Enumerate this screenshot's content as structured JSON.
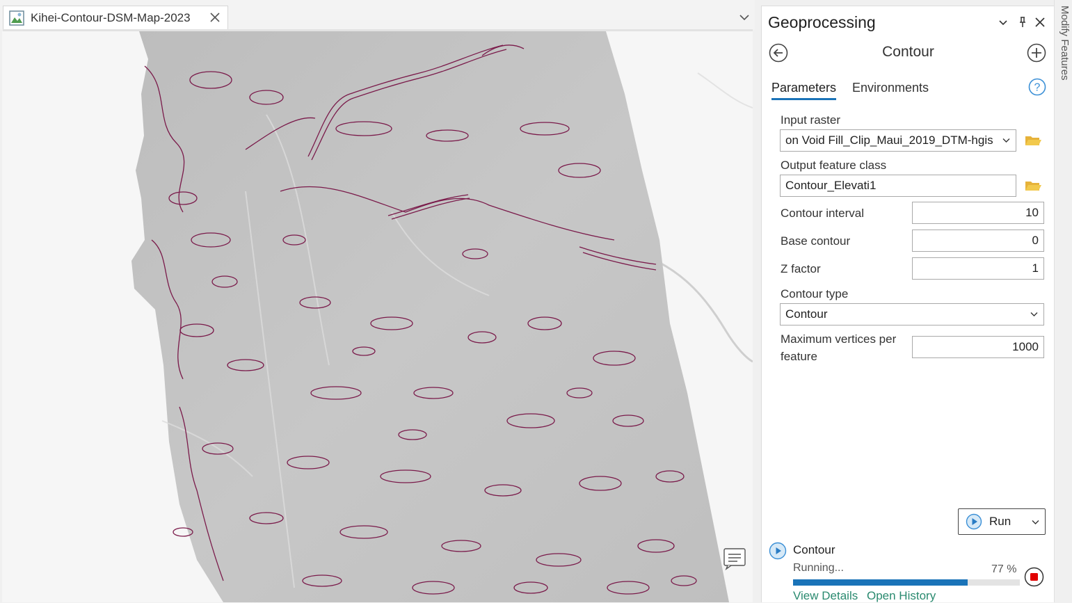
{
  "map_view": {
    "tab_title": "Kihei-Contour-DSM-Map-2023",
    "map_icon": "map-icon",
    "contour_color": "#7a1a4a"
  },
  "geoprocessing": {
    "pane_title": "Geoprocessing",
    "tool_name": "Contour",
    "tabs": {
      "parameters": "Parameters",
      "environments": "Environments"
    },
    "parameters": {
      "input_raster": {
        "label": "Input raster",
        "value": "on Void Fill_Clip_Maui_2019_DTM-hgis"
      },
      "output_feature_class": {
        "label": "Output feature class",
        "value": "Contour_Elevati1"
      },
      "contour_interval": {
        "label": "Contour interval",
        "value": "10"
      },
      "base_contour": {
        "label": "Base contour",
        "value": "0"
      },
      "z_factor": {
        "label": "Z factor",
        "value": "1"
      },
      "contour_type": {
        "label": "Contour type",
        "value": "Contour"
      },
      "max_vertices": {
        "label_line1": "Maximum vertices per",
        "label_line2": "feature",
        "value": "1000"
      }
    },
    "run_label": "Run",
    "job": {
      "name": "Contour",
      "status": "Running...",
      "percent_text": "77 %",
      "progress": 0.77,
      "view_details": "View Details",
      "open_history": "Open History"
    },
    "accent_color": "#1a73b8"
  },
  "side_strip": {
    "label": "Modify Features"
  }
}
